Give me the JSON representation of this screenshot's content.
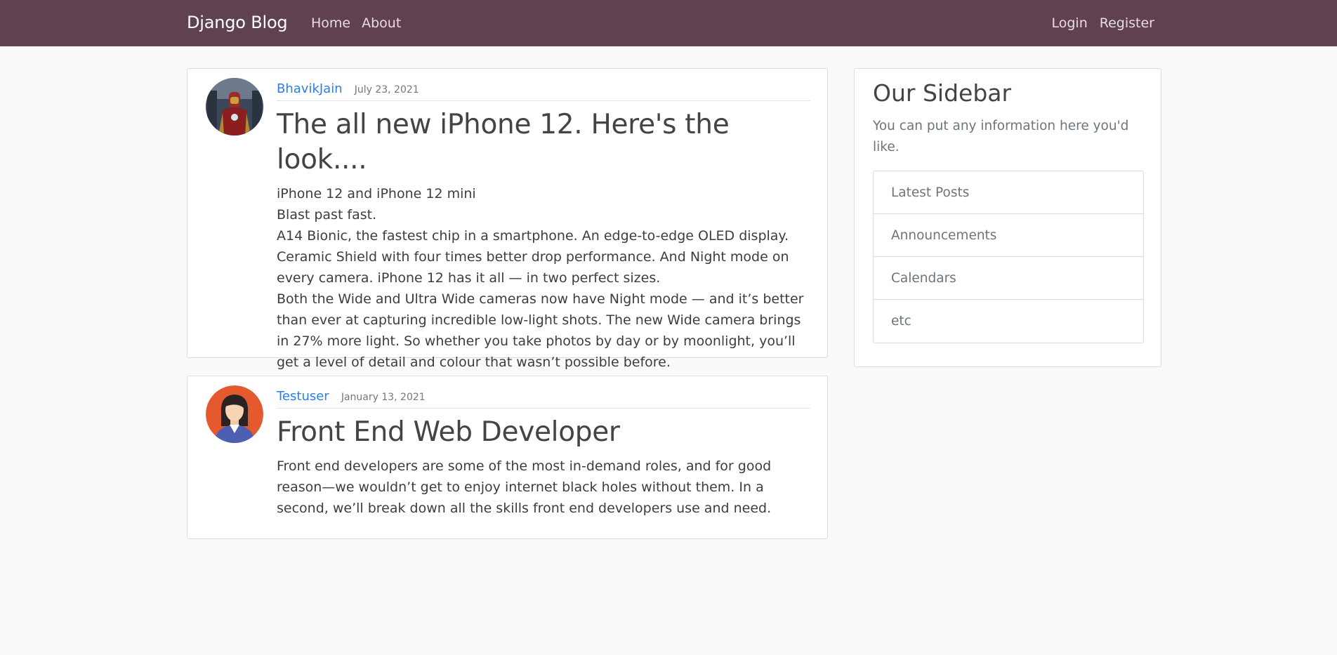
{
  "navbar": {
    "brand": "Django Blog",
    "links_left": [
      "Home",
      "About"
    ],
    "links_right": [
      "Login",
      "Register"
    ],
    "background": "#5f4150"
  },
  "posts": [
    {
      "author": "BhavikJain",
      "date": "July 23, 2021",
      "title": "The all new iPhone 12. Here's the look....",
      "lines": [
        "iPhone 12 and iPhone 12 mini",
        "Blast past fast.",
        "A14 Bionic, the fastest chip in a smartphone. An edge-to-edge OLED display. Ceramic Shield with four times better drop performance. And Night mode on every camera. iPhone 12 has it all — in two perfect sizes.",
        "Both the Wide and Ultra Wide cameras now have Night mode — and it’s better than ever at capturing incredible low-light shots. The new Wide camera brings in 27% more light. So whether you take photos by day or by moonlight, you’ll get a level of detail and colour that wasn’t possible before."
      ]
    },
    {
      "author": "Testuser",
      "date": "January 13, 2021",
      "title": "Front End Web Developer",
      "lines": [
        "Front end developers are some of the most in-demand roles, and for good reason—we wouldn’t get to enjoy internet black holes without them. In a second, we’ll break down all the skills front end developers use and need."
      ]
    }
  ],
  "sidebar": {
    "title": "Our Sidebar",
    "text": "You can put any information here you'd like.",
    "items": [
      "Latest Posts",
      "Announcements",
      "Calendars",
      "etc"
    ]
  },
  "colors": {
    "link": "#2c7ee8",
    "page_background": "#fafafa"
  }
}
